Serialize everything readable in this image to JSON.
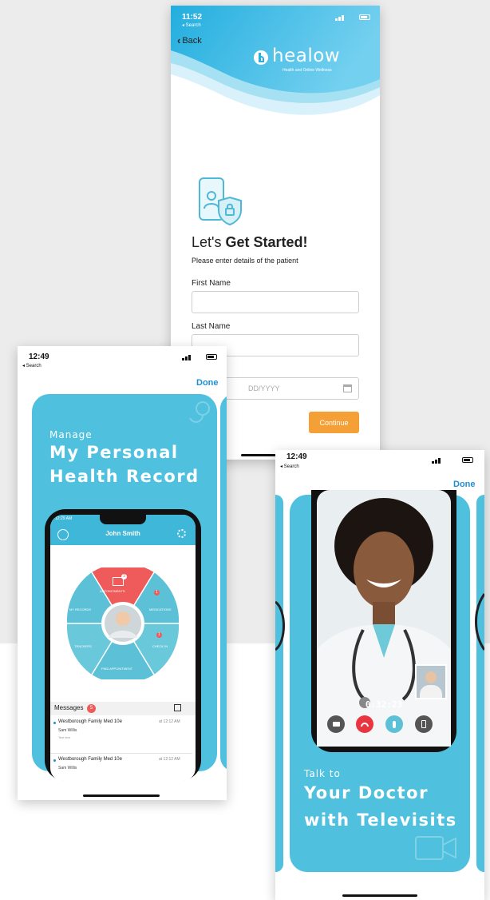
{
  "colors": {
    "brand_blue": "#4fc0de",
    "accent_orange": "#f4a037",
    "link_blue": "#1e8fd6",
    "header_grad_start": "#2bb4e0",
    "header_grad_end": "#8fd8f0"
  },
  "registration": {
    "status_time": "11:52",
    "status_back": "◂ Search",
    "back_label": "Back",
    "brand_name": "healow",
    "brand_tagline": "Health and Online Wellness",
    "heading_pre": "Let's ",
    "heading_bold": "Get Started!",
    "subheading": "Please enter details of the patient",
    "fields": [
      {
        "label": "First Name",
        "value": ""
      },
      {
        "label": "Last Name",
        "value": ""
      }
    ],
    "dob_placeholder": "DD/YYYY",
    "continue_label": "Continue"
  },
  "phr": {
    "status_time": "12:49",
    "status_back": "◂ Search",
    "done_label": "Done",
    "kicker": "Manage",
    "title_line1": "My Personal",
    "title_line2": "Health Record",
    "inner": {
      "time": "12:29 AM",
      "user_name": "John Smith",
      "segments": {
        "appointments": "APPOINTMENTS",
        "my_records": "MY RECORDS",
        "medications": "MEDICATIONS",
        "trackers": "TRACKERS",
        "check_in": "CHECK IN",
        "find_appointment": "FIND APPOINTMENT"
      },
      "appointments_badge": "3",
      "medications_badge": "1",
      "checkin_badge": "1",
      "messages_label": "Messages",
      "messages_count": "5",
      "messages": [
        {
          "title": "Westborough Family Med 10e",
          "time": "at 12:12 AM",
          "sender": "Sam Willis",
          "preview": "Test text"
        },
        {
          "title": "Westborough Family Med 10e",
          "time": "at 12:12 AM",
          "sender": "Sam Willis",
          "preview": ""
        }
      ]
    }
  },
  "televisit": {
    "status_time": "12:49",
    "status_back": "◂ Search",
    "done_label": "Done",
    "call_timer": "0:32:23",
    "kicker": "Talk to",
    "title_line1": "Your Doctor",
    "title_line2": "with Televisits"
  }
}
